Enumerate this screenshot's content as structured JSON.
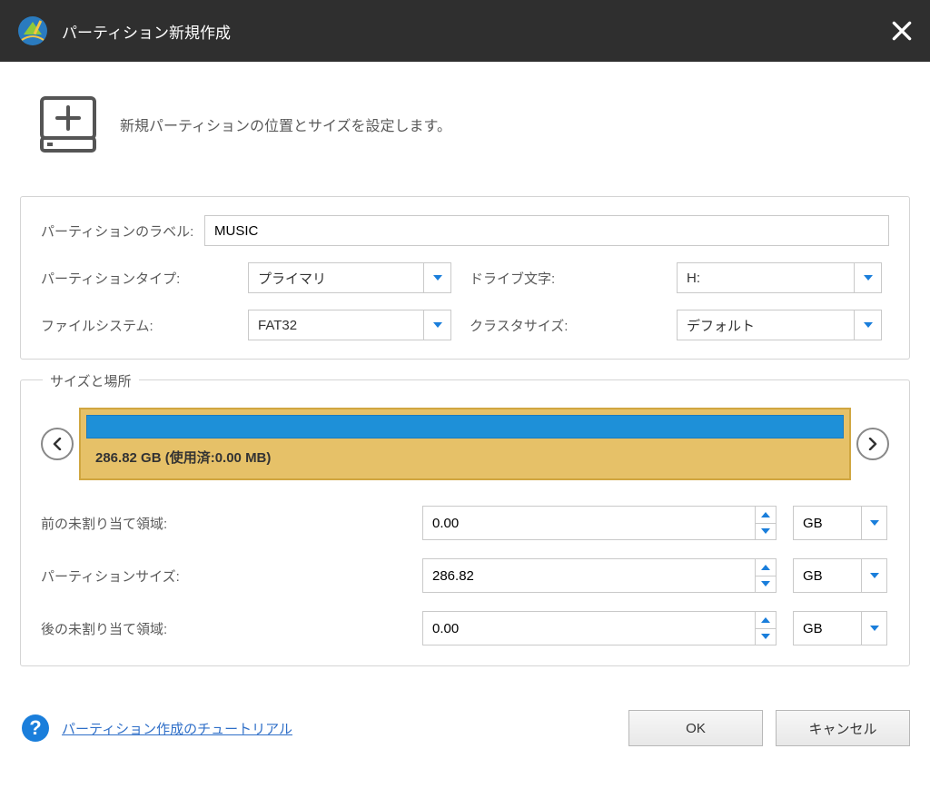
{
  "window": {
    "title": "パーティション新規作成"
  },
  "intro": {
    "text": "新規パーティションの位置とサイズを設定します。"
  },
  "settings": {
    "label_label": "パーティションのラベル:",
    "label_value": "MUSIC",
    "type_label": "パーティションタイプ:",
    "type_value": "プライマリ",
    "drive_label": "ドライブ文字:",
    "drive_value": "H:",
    "fs_label": "ファイルシステム:",
    "fs_value": "FAT32",
    "cluster_label": "クラスタサイズ:",
    "cluster_value": "デフォルト"
  },
  "sizeloc": {
    "legend": "サイズと場所",
    "disk_label": "286.82 GB (使用済:0.00 MB)",
    "before_label": "前の未割り当て領域:",
    "before_value": "0.00",
    "before_unit": "GB",
    "size_label": "パーティションサイズ:",
    "size_value": "286.82",
    "size_unit": "GB",
    "after_label": "後の未割り当て領域:",
    "after_value": "0.00",
    "after_unit": "GB"
  },
  "footer": {
    "tutorial": "パーティション作成のチュートリアル",
    "ok": "OK",
    "cancel": "キャンセル"
  }
}
